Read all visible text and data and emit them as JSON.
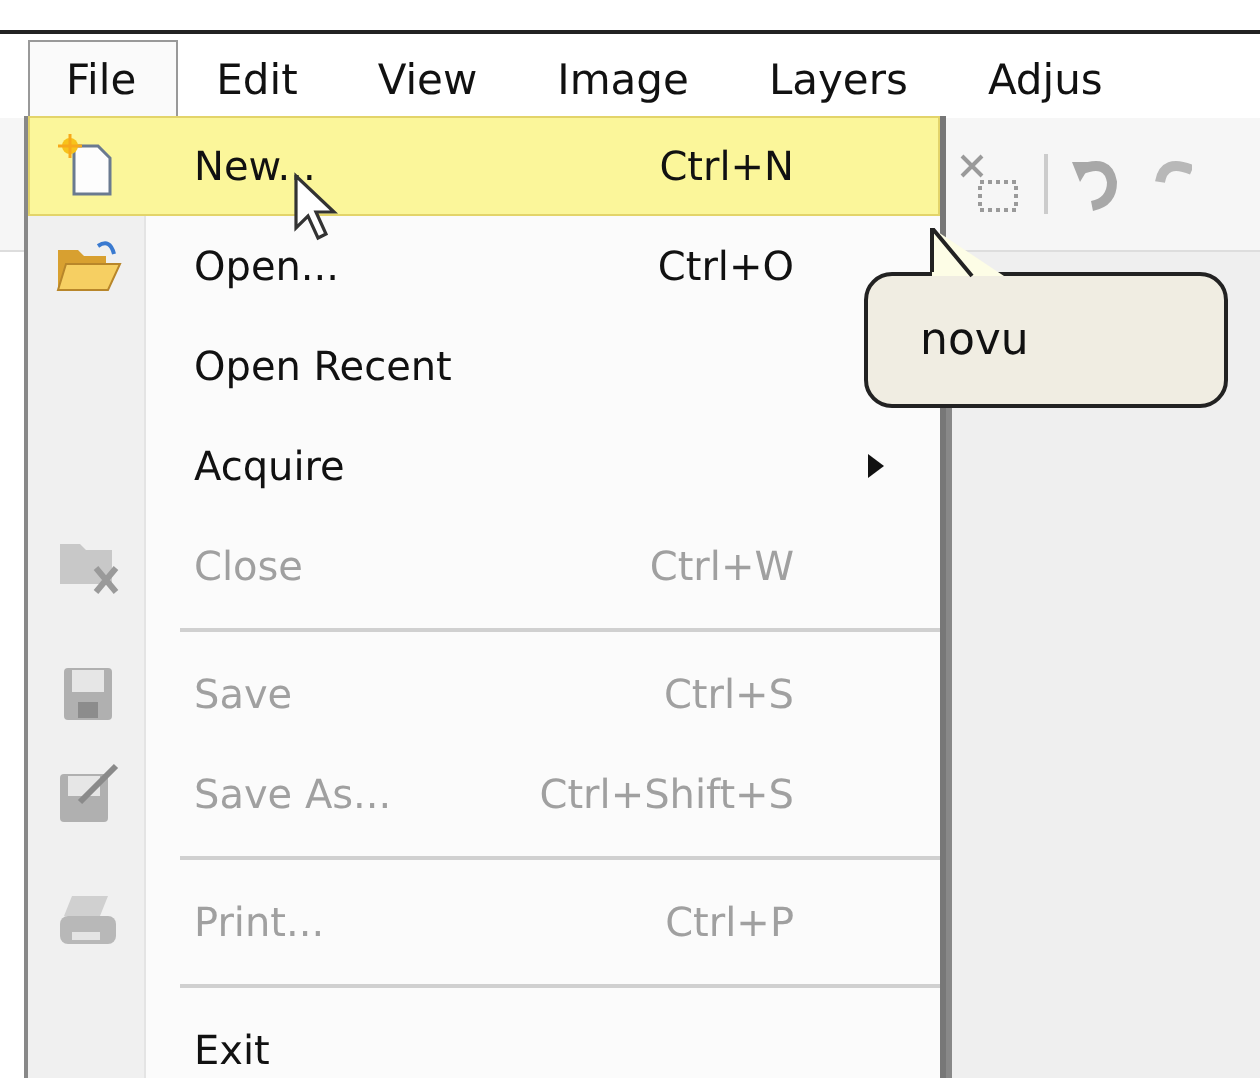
{
  "menubar": [
    {
      "label": "File",
      "selected": true
    },
    {
      "label": "Edit",
      "selected": false
    },
    {
      "label": "View",
      "selected": false
    },
    {
      "label": "Image",
      "selected": false
    },
    {
      "label": "Layers",
      "selected": false
    },
    {
      "label": "Adjus",
      "selected": false
    }
  ],
  "file_menu": [
    {
      "kind": "item",
      "label": "New...",
      "shortcut": "Ctrl+N",
      "disabled": false,
      "selected": true
    },
    {
      "kind": "item",
      "label": "Open...",
      "shortcut": "Ctrl+O",
      "disabled": false,
      "selected": false
    },
    {
      "kind": "item",
      "label": "Open Recent",
      "disabled": false,
      "selected": false
    },
    {
      "kind": "submenu",
      "label": "Acquire",
      "disabled": false,
      "selected": false
    },
    {
      "kind": "item",
      "label": "Close",
      "shortcut": "Ctrl+W",
      "disabled": true,
      "selected": false
    },
    {
      "kind": "separator"
    },
    {
      "kind": "item",
      "label": "Save",
      "shortcut": "Ctrl+S",
      "disabled": true,
      "selected": false
    },
    {
      "kind": "item",
      "label": "Save As...",
      "shortcut": "Ctrl+Shift+S",
      "disabled": true,
      "selected": false
    },
    {
      "kind": "separator"
    },
    {
      "kind": "item",
      "label": "Print...",
      "shortcut": "Ctrl+P",
      "disabled": true,
      "selected": false
    },
    {
      "kind": "separator"
    },
    {
      "kind": "item",
      "label": "Exit",
      "disabled": false,
      "selected": false
    }
  ],
  "tooltip": {
    "text": "novu"
  }
}
